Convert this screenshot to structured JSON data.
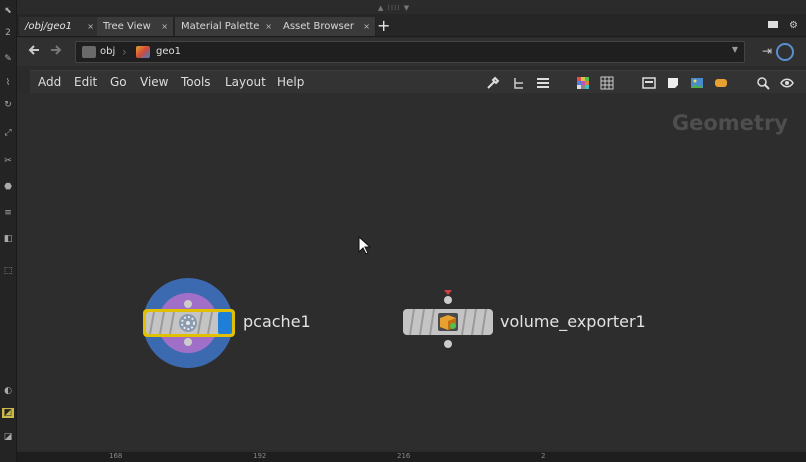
{
  "left_toolbar": {
    "glyphs": [
      "⬉",
      "2",
      "✎",
      "⌇",
      "↻",
      "⤢",
      "✂",
      "⬣",
      "≡",
      "◧",
      "⬚",
      "◐",
      "◩",
      "◪"
    ]
  },
  "tabs": [
    {
      "label": "/obj/geo1",
      "active": true
    },
    {
      "label": "Tree View",
      "active": false
    },
    {
      "label": "Material Palette",
      "active": false
    },
    {
      "label": "Asset Browser",
      "active": false
    }
  ],
  "tab_close_symbol": "×",
  "add_tab_symbol": "+",
  "path": {
    "back_icon": "arrow-left-icon",
    "forward_icon": "arrow-right-icon",
    "crumbs": [
      {
        "label": "obj",
        "icon": "obj-network-icon"
      },
      {
        "label": "geo1",
        "icon": "geo-node-icon"
      }
    ]
  },
  "menu": {
    "items": [
      "Add",
      "Edit",
      "Go",
      "View",
      "Tools",
      "Layout",
      "Help"
    ]
  },
  "toolbar_icons": [
    "wrench-icon",
    "tree-icon",
    "list-icon",
    "color-grid-icon",
    "grid-icon",
    "network-box-icon",
    "sticky-note-icon",
    "image-icon",
    "badge-icon",
    "search-icon",
    "eye-icon"
  ],
  "canvas": {
    "context_label": "Geometry",
    "nodes": [
      {
        "name": "pcache1",
        "type": "pcache",
        "selected": true,
        "display_flag": true
      },
      {
        "name": "volume_exporter1",
        "type": "volume_exporter",
        "selected": false,
        "display_flag": false
      }
    ]
  },
  "ruler": {
    "ticks": [
      "168",
      "192",
      "216",
      "2"
    ]
  },
  "colors": {
    "background": "#2d2d2d",
    "selected_outline": "#e0c000",
    "display_flag": "#1f7fd6",
    "node_ring": "#3c6ab0",
    "node_ring_inner": "#a070c8",
    "input_marker": "#d04040"
  }
}
